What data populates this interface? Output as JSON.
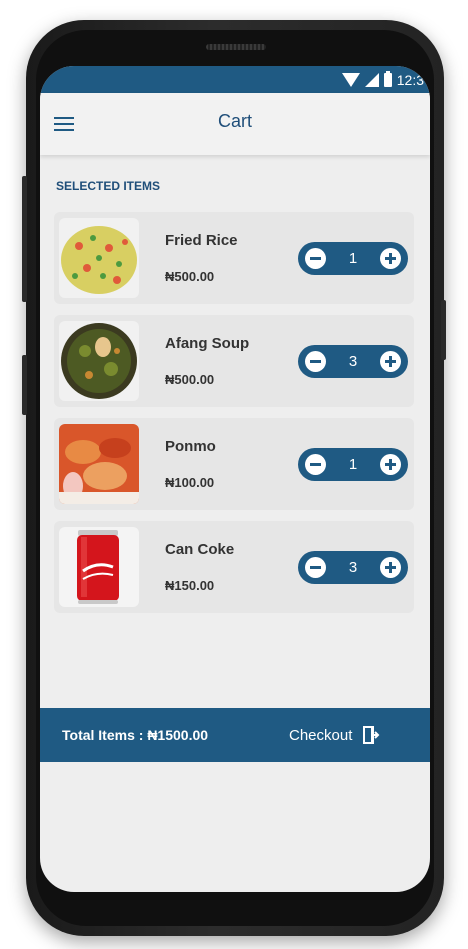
{
  "status_bar": {
    "time": "12:3",
    "icons": [
      "wifi-icon",
      "signal-icon",
      "battery-icon"
    ]
  },
  "header": {
    "title": "Cart",
    "menu_icon": "hamburger-menu-icon"
  },
  "section_title": "SELECTED ITEMS",
  "items": [
    {
      "name": "Fried Rice",
      "price": "₦500.00",
      "quantity": "1",
      "image": "fried-rice-image"
    },
    {
      "name": "Afang Soup",
      "price": "₦500.00",
      "quantity": "3",
      "image": "afang-soup-image"
    },
    {
      "name": "Ponmo",
      "price": "₦100.00",
      "quantity": "1",
      "image": "ponmo-image"
    },
    {
      "name": "Can Coke",
      "price": "₦150.00",
      "quantity": "3",
      "image": "coke-can-image"
    }
  ],
  "footer": {
    "total_label": "Total Items :",
    "total_value": "₦1500.00",
    "checkout_label": "Checkout",
    "checkout_icon": "exit-door-icon"
  },
  "colors": {
    "primary": "#1f5a83",
    "screen_bg": "#eeeeee",
    "card_bg": "#e6e6e6"
  }
}
